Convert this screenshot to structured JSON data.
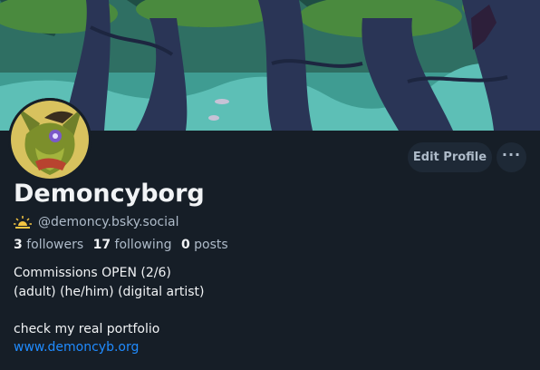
{
  "profile": {
    "display_name": "Demoncyborg",
    "handle": "@demoncy.bsky.social",
    "handle_icon": "sunrise-icon"
  },
  "actions": {
    "edit_label": "Edit Profile",
    "more_label": "···",
    "more_icon": "ellipsis-icon"
  },
  "stats": {
    "followers_count": "3",
    "followers_label": "followers",
    "following_count": "17",
    "following_label": "following",
    "posts_count": "0",
    "posts_label": "posts"
  },
  "bio": {
    "line1": "Commissions OPEN (2/6)",
    "line2": "(adult) (he/him) (digital artist)",
    "line3": "",
    "line4": "check my real portfolio",
    "link": "www.demoncyb.org"
  },
  "colors": {
    "background": "#161e27",
    "accent_link": "#208bfe",
    "muted_text": "#aebbc9",
    "button_bg": "#1e2936"
  }
}
